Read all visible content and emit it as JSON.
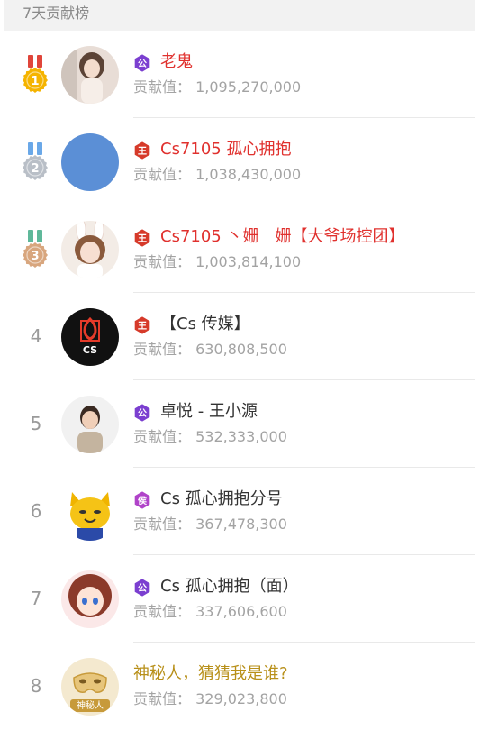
{
  "header": {
    "title": "7天贡献榜"
  },
  "contrib_label": "贡献值：",
  "entries": [
    {
      "rank": "1",
      "name": "老鬼",
      "value": "1,095,270,000",
      "name_color": "red",
      "badge": "gong-icon",
      "badge_char": "公",
      "badge_color": "#7b3fd0",
      "avatar": "girl-photo-avatar"
    },
    {
      "rank": "2",
      "name": "Cs7105 孤心拥抱",
      "value": "1,038,430,000",
      "name_color": "red",
      "badge": "wang-icon",
      "badge_char": "王",
      "badge_color": "#d63a2a",
      "avatar": "blue-circle-avatar"
    },
    {
      "rank": "3",
      "name": "Cs7105 丶姗　姗【大爷场控团】",
      "value": "1,003,814,100",
      "name_color": "red",
      "badge": "wang-icon",
      "badge_char": "王",
      "badge_color": "#d63a2a",
      "avatar": "girl-bunny-avatar"
    },
    {
      "rank": "4",
      "name": "【Cs 传媒】",
      "value": "630,808,500",
      "name_color": "dark",
      "badge": "wang-icon",
      "badge_char": "王",
      "badge_color": "#d63a2a",
      "avatar": "cs-media-logo-avatar"
    },
    {
      "rank": "5",
      "name": "卓悦 - 王小源",
      "value": "532,333,000",
      "name_color": "dark",
      "badge": "gong-icon",
      "badge_char": "公",
      "badge_color": "#7b3fd0",
      "avatar": "man-photo-avatar"
    },
    {
      "rank": "6",
      "name": "Cs 孤心拥抱分号",
      "value": "367,478,300",
      "name_color": "dark",
      "badge": "hou-icon",
      "badge_char": "侯",
      "badge_color": "#b043c9",
      "avatar": "cartoon-cat-avatar"
    },
    {
      "rank": "7",
      "name": "Cs 孤心拥抱（面）",
      "value": "337,606,600",
      "name_color": "dark",
      "badge": "gong-icon",
      "badge_char": "公",
      "badge_color": "#7b3fd0",
      "avatar": "anime-girl-avatar"
    },
    {
      "rank": "8",
      "name": "神秘人，猜猜我是谁?",
      "value": "329,023,800",
      "name_color": "gold",
      "badge": "",
      "badge_char": "",
      "badge_color": "",
      "avatar": "mystery-mask-avatar",
      "avatar_text": "神秘人"
    }
  ],
  "medal_colors": {
    "1": {
      "ribbon": "#e0453a",
      "disc": "#f5b400",
      "text": "#ffffff"
    },
    "2": {
      "ribbon": "#6aa8e8",
      "disc": "#b9bfc7",
      "text": "#ffffff"
    },
    "3": {
      "ribbon": "#5fb89a",
      "disc": "#d8a67e",
      "text": "#ffffff"
    }
  }
}
